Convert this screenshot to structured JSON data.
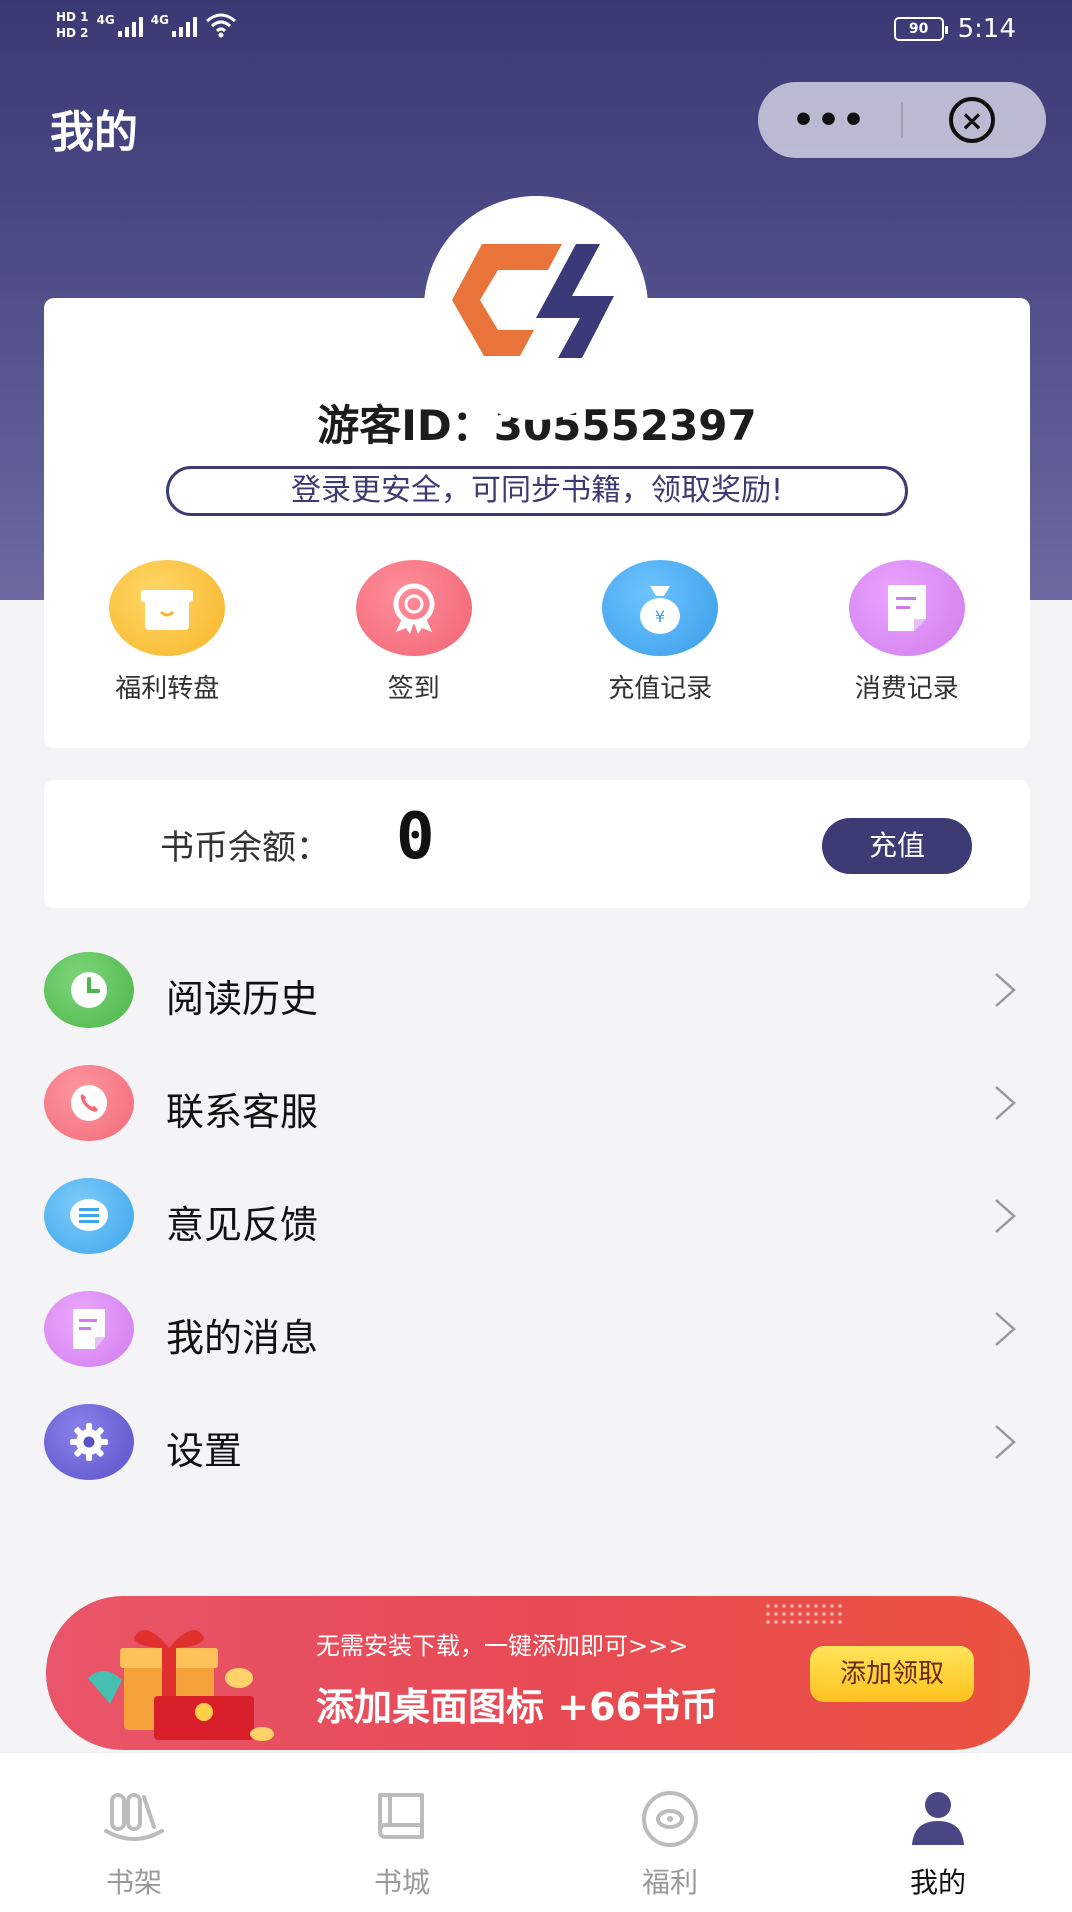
{
  "status_bar": {
    "hd1": "HD 1",
    "hd2": "HD 2",
    "sig1_label": "4G",
    "sig2_label": "4G",
    "battery": "90",
    "time": "5:14"
  },
  "header": {
    "title": "我的",
    "more_label": "•••",
    "close_label": "×"
  },
  "profile": {
    "guest_id": "游客ID：305552397",
    "login_tip": "登录更安全，可同步书籍，领取奖励!",
    "actions": [
      {
        "label": "福利转盘",
        "icon": "gift-icon",
        "color": "#ffc63c"
      },
      {
        "label": "签到",
        "icon": "medal-icon",
        "color": "#f6707e"
      },
      {
        "label": "充值记录",
        "icon": "money-bag-icon",
        "color": "#48a9ee"
      },
      {
        "label": "消费记录",
        "icon": "receipt-icon",
        "color": "#d889ef"
      }
    ]
  },
  "balance": {
    "label": "书币余额：",
    "value": "0",
    "recharge_label": "充值"
  },
  "menu": [
    {
      "label": "阅读历史",
      "icon": "clock-icon",
      "color": "#5dc35a"
    },
    {
      "label": "联系客服",
      "icon": "phone-icon",
      "color": "#f57a86"
    },
    {
      "label": "意见反馈",
      "icon": "message-icon",
      "color": "#4db3f2"
    },
    {
      "label": "我的消息",
      "icon": "note-icon",
      "color": "#db8cf0"
    },
    {
      "label": "设置",
      "icon": "gear-icon",
      "color": "#6b63d6"
    }
  ],
  "banner": {
    "subtitle": "无需安装下载，一键添加即可>>>",
    "title": "添加桌面图标 +66书币",
    "button_label": "添加领取"
  },
  "tabbar": [
    {
      "label": "书架",
      "icon": "bookshelf-icon",
      "active": false
    },
    {
      "label": "书城",
      "icon": "book-icon",
      "active": false
    },
    {
      "label": "福利",
      "icon": "welfare-icon",
      "active": false
    },
    {
      "label": "我的",
      "icon": "person-icon",
      "active": true
    }
  ],
  "colors": {
    "brand": "#3c3b74",
    "logo_orange": "#e8743a"
  }
}
